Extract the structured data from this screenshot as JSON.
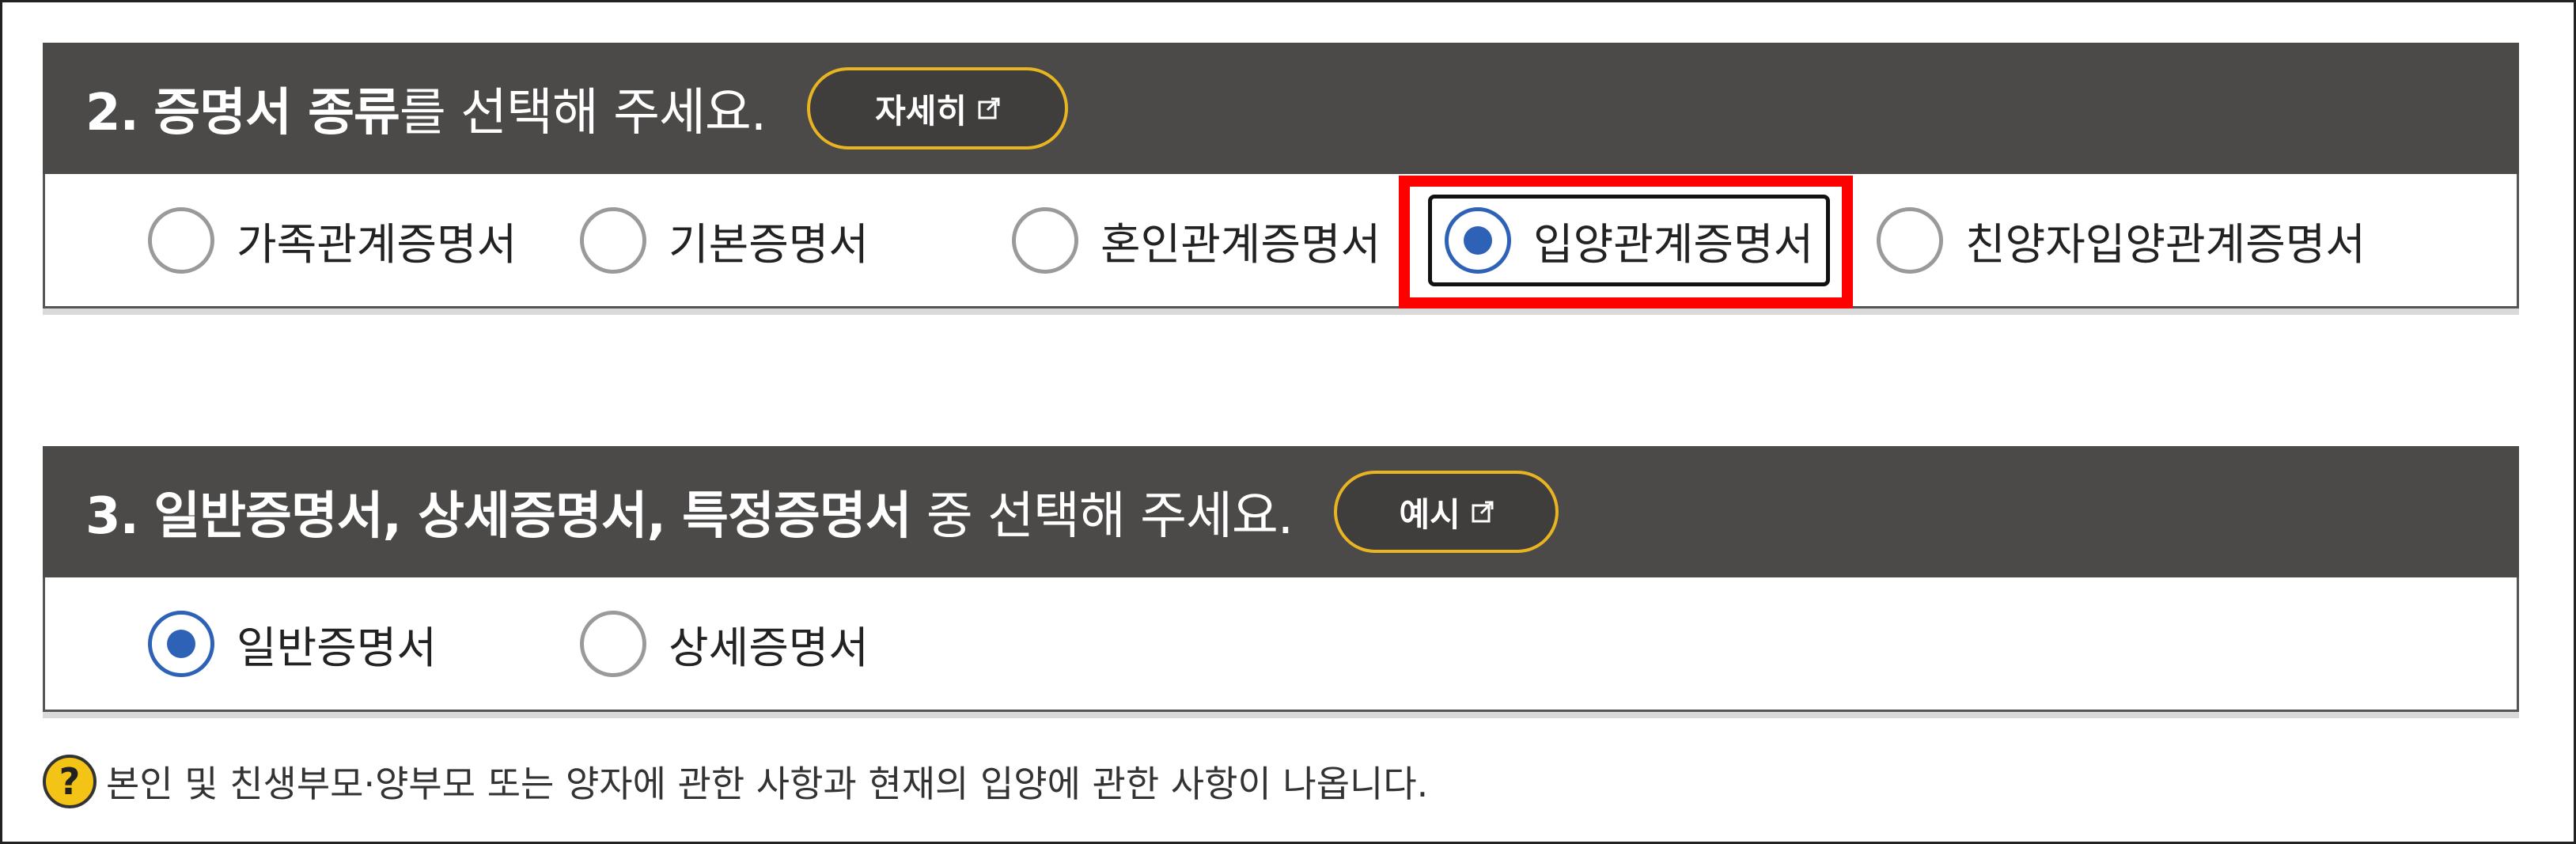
{
  "section2": {
    "header_num": "2.",
    "header_bold": "증명서 종류",
    "header_rest": "를 선택해 주세요.",
    "detail_button": "자세히",
    "options": [
      {
        "label": "가족관계증명서",
        "checked": false
      },
      {
        "label": "기본증명서",
        "checked": false
      },
      {
        "label": "혼인관계증명서",
        "checked": false
      },
      {
        "label": "입양관계증명서",
        "checked": true
      },
      {
        "label": "친양자입양관계증명서",
        "checked": false
      }
    ]
  },
  "section3": {
    "header_num": "3.",
    "header_bold": "일반증명서, 상세증명서, 특정증명서",
    "header_rest": " 중 선택해 주세요.",
    "example_button": "예시",
    "options": [
      {
        "label": "일반증명서",
        "checked": true
      },
      {
        "label": "상세증명서",
        "checked": false
      }
    ]
  },
  "note": {
    "icon": "question-icon",
    "text": "본인 및 친생부모·양부모 또는 양자에 관한 사항과 현재의 입양에 관한 사항이 나옵니다."
  },
  "colors": {
    "header_bg": "#4b4a49",
    "accent_border": "#e8b422",
    "radio_checked": "#2e62b7",
    "highlight": "#ff0000"
  }
}
